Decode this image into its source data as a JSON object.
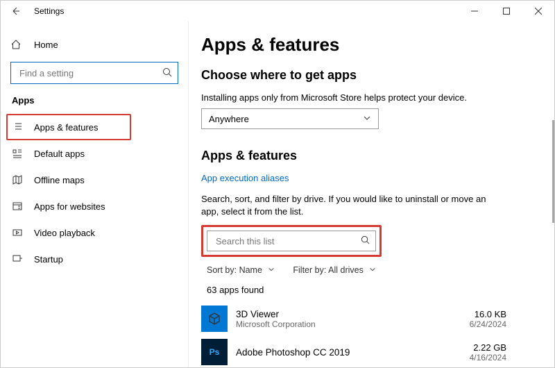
{
  "window": {
    "title": "Settings"
  },
  "sidebar": {
    "home": "Home",
    "search_placeholder": "Find a setting",
    "category": "Apps",
    "items": [
      {
        "label": "Apps & features"
      },
      {
        "label": "Default apps"
      },
      {
        "label": "Offline maps"
      },
      {
        "label": "Apps for websites"
      },
      {
        "label": "Video playback"
      },
      {
        "label": "Startup"
      }
    ]
  },
  "main": {
    "title": "Apps & features",
    "choose_heading": "Choose where to get apps",
    "choose_desc": "Installing apps only from Microsoft Store helps protect your device.",
    "choose_value": "Anywhere",
    "list_heading": "Apps & features",
    "aliases_link": "App execution aliases",
    "instructions": "Search, sort, and filter by drive. If you would like to uninstall or move an app, select it from the list.",
    "list_search_placeholder": "Search this list",
    "sort_label": "Sort by:",
    "sort_value": "Name",
    "filter_label": "Filter by:",
    "filter_value": "All drives",
    "count_text": "63 apps found",
    "apps": [
      {
        "name": "3D Viewer",
        "publisher": "Microsoft Corporation",
        "size": "16.0 KB",
        "date": "6/24/2024"
      },
      {
        "name": "Adobe Photoshop CC 2019",
        "publisher": "",
        "size": "2.22 GB",
        "date": "4/16/2024"
      }
    ]
  }
}
